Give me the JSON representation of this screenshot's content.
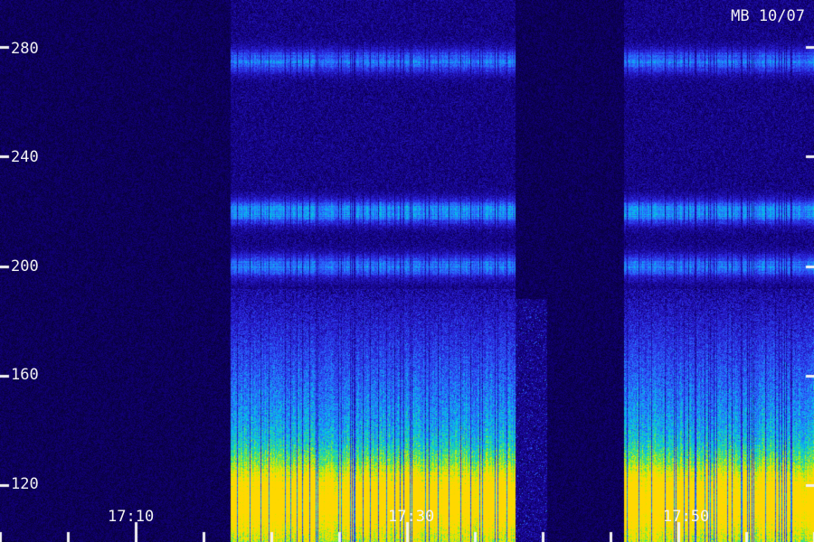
{
  "chart_data": {
    "type": "heatmap",
    "title": "MB 10/07",
    "xlabel": "",
    "ylabel": "",
    "y_ticks": [
      120,
      160,
      200,
      240,
      280
    ],
    "ylim": [
      106,
      290
    ],
    "x_ticks": [
      "17:10",
      "17:30",
      "17:50"
    ],
    "colormap": [
      "#000000",
      "#12007a",
      "#2a20d8",
      "#2a6cff",
      "#00c8e8",
      "#3ee070",
      "#c8f000",
      "#ffd800"
    ],
    "bands": [
      {
        "center": 275,
        "level": "high"
      },
      {
        "center": 220,
        "level": "very high"
      },
      {
        "center": 200,
        "level": "high"
      },
      {
        "center": 115,
        "level": "maximum"
      }
    ],
    "activity": [
      {
        "start": "17:17",
        "end": "17:38",
        "level": "on"
      },
      {
        "start": "17:38",
        "end": "17:46",
        "level": "low"
      },
      {
        "start": "17:46",
        "end": "18:00",
        "level": "on"
      }
    ]
  }
}
